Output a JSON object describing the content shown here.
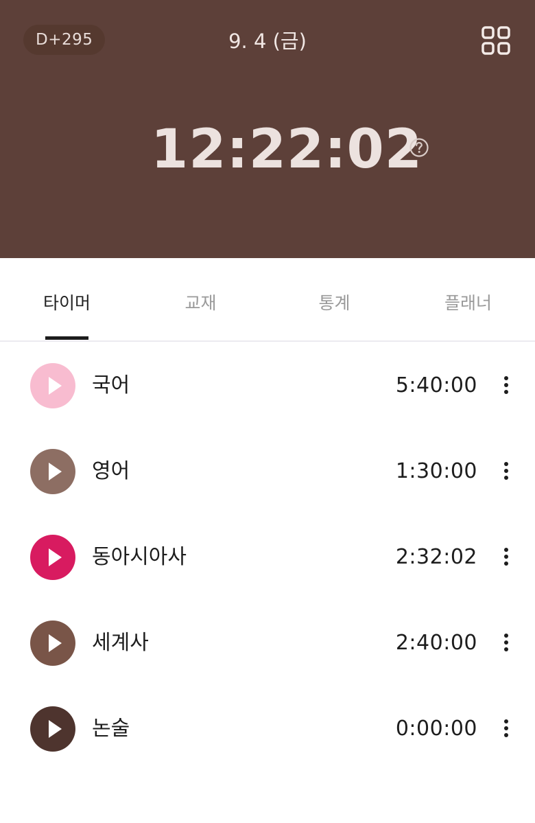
{
  "header": {
    "dday": "D+295",
    "date": "9. 4 (금)",
    "timer": "12:22:02",
    "bg_color": "#5d4039",
    "menu_icon": "grid-icon",
    "help_icon": "help-circle-icon"
  },
  "tabs": [
    {
      "label": "타이머",
      "active": true
    },
    {
      "label": "교재",
      "active": false
    },
    {
      "label": "통계",
      "active": false
    },
    {
      "label": "플래너",
      "active": false
    }
  ],
  "subjects": [
    {
      "name": "국어",
      "time": "5:40:00",
      "color": "#f8bcd0"
    },
    {
      "name": "영어",
      "time": "1:30:00",
      "color": "#8d6e63"
    },
    {
      "name": "동아시아사",
      "time": "2:32:02",
      "color": "#d81b60"
    },
    {
      "name": "세계사",
      "time": "2:40:00",
      "color": "#795548"
    },
    {
      "name": "논술",
      "time": "0:00:00",
      "color": "#4e342e"
    }
  ]
}
